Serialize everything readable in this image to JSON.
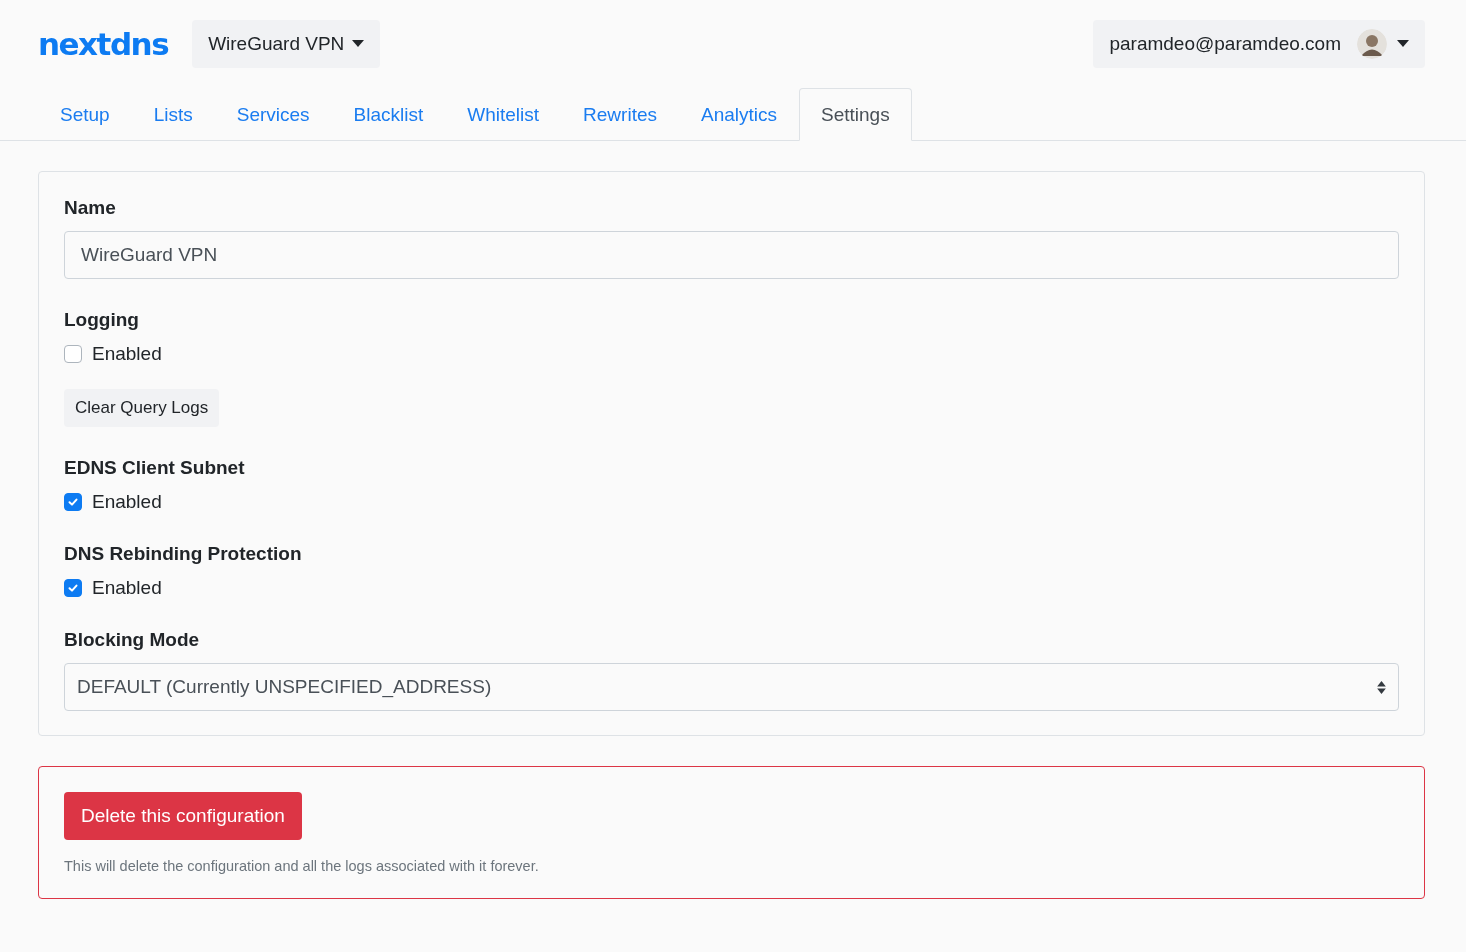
{
  "header": {
    "logo": "nextdns",
    "configuration": "WireGuard VPN",
    "account": "paramdeo@paramdeo.com"
  },
  "tabs": [
    {
      "label": "Setup",
      "selected": false
    },
    {
      "label": "Lists",
      "selected": false
    },
    {
      "label": "Services",
      "selected": false
    },
    {
      "label": "Blacklist",
      "selected": false
    },
    {
      "label": "Whitelist",
      "selected": false
    },
    {
      "label": "Rewrites",
      "selected": false
    },
    {
      "label": "Analytics",
      "selected": false
    },
    {
      "label": "Settings",
      "selected": true
    }
  ],
  "settings": [
    {
      "kind": "text",
      "label": "Name",
      "value": "WireGuard VPN"
    },
    {
      "kind": "checkbox",
      "label": "Logging",
      "option": "Enabled",
      "checked": false,
      "button": "Clear Query Logs"
    },
    {
      "kind": "checkbox",
      "label": "EDNS Client Subnet",
      "option": "Enabled",
      "checked": true
    },
    {
      "kind": "checkbox",
      "label": "DNS Rebinding Protection",
      "option": "Enabled",
      "checked": true
    },
    {
      "kind": "select",
      "label": "Blocking Mode",
      "value": "DEFAULT (Currently UNSPECIFIED_ADDRESS)"
    }
  ],
  "danger": {
    "button": "Delete this configuration",
    "note": "This will delete the configuration and all the logs associated with it forever."
  }
}
